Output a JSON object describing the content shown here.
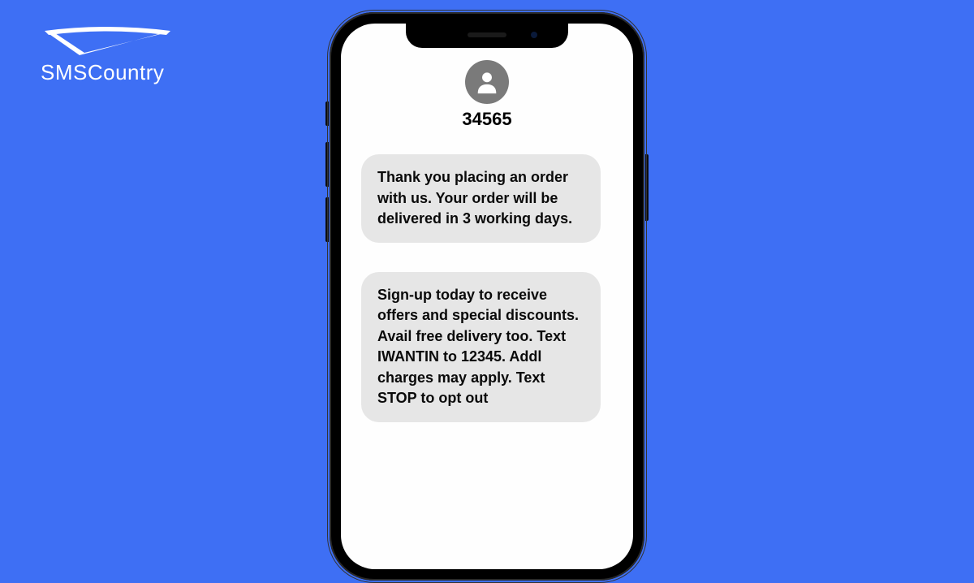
{
  "logo": {
    "text": "SMSCountry"
  },
  "phone": {
    "sender_number": "34565",
    "messages": [
      "Thank you placing an order with us. Your order will be delivered in 3 working days.",
      "Sign-up today to receive offers and special discounts. Avail free delivery too. Text IWANTIN to 12345. Addl charges may apply. Text STOP to opt out"
    ]
  }
}
